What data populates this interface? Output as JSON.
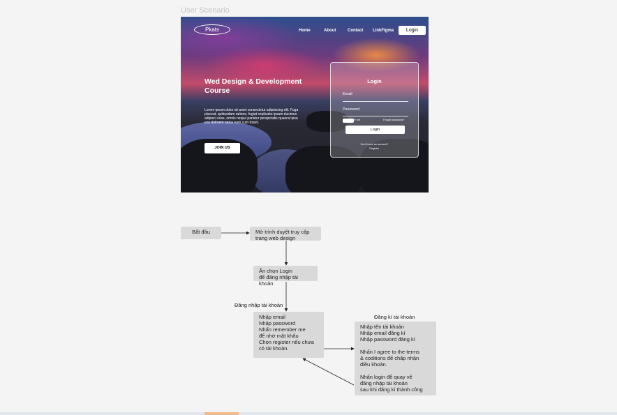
{
  "page_title": "User Scenario",
  "mockup": {
    "logo": "Pkats",
    "nav": [
      "Home",
      "About",
      "Contact",
      "LinkFigma"
    ],
    "login_button": "Login",
    "hero_title": "Wed Design & Development Course",
    "hero_text": "Lorem ipsum dolor sit amet consectetur adipisicing elit. Fuga placeat, quibusdam ratione, fugiat explicabo ipsam ducimus adipisci esse, omnis neque pariatur perspiciatis quaerat ipsa eos dolorem natus nam cum totam.",
    "join_button": "JOIN US",
    "card": {
      "title": "Login",
      "email_label": "Email",
      "password_label": "Password",
      "remember": "Remember me",
      "forgot": "Forgot password?",
      "submit": "Login",
      "no_account": "Don't have an account?",
      "register": "Register"
    }
  },
  "flow": {
    "start": "Bắt đầu",
    "open_browser": "Mở trình duyệt truy cập\ntrang web design",
    "choose_login": "Ấn chọn Login\nđể đăng nhập tài khoản",
    "login_label": "Đăng nhập tài khoản",
    "login_steps": "Nhập email\nNhập password\nNhấn remember me\nđể nhớ mật khẩu\nChọn register nếu chưa\ncó tài khoản.",
    "register_label": "Đăng kí tài khoản",
    "register_steps": "Nhập tên tài khoản\nNhập email đăng kí\nNhập password đăng kí\n\nNhấn I agree to the terms\n& coditions để chấp nhận\nđiều khoản.\n\nNhấn login để quay về\nđăng nhập tài khoản\nsau khi đăng kí thành công"
  }
}
